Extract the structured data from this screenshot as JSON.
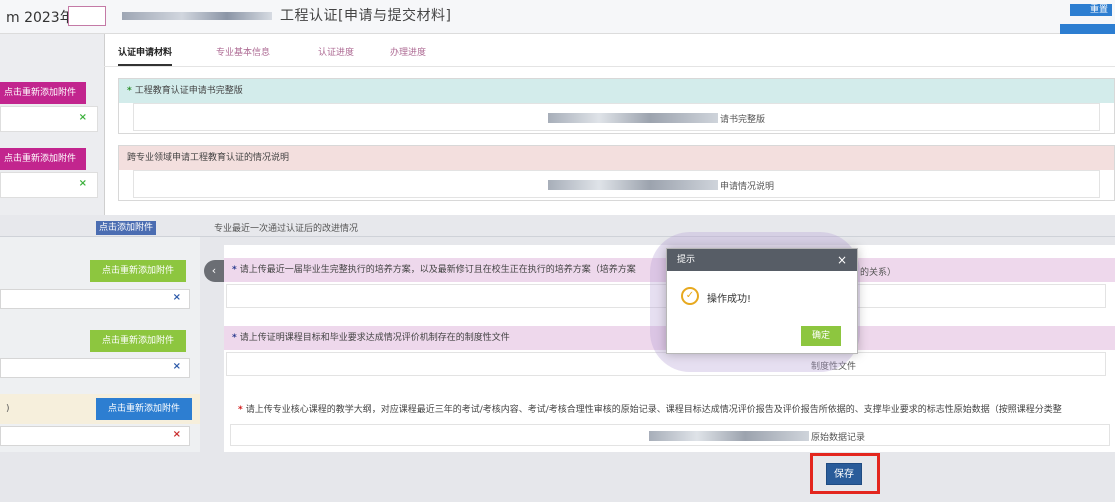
{
  "header": {
    "title_prefix": "m 2023年度",
    "logo_text": "",
    "title": "工程认证[申请与提交材料]",
    "button_label": "重置"
  },
  "tabs": [
    {
      "label": "认证申请材料",
      "active": true
    },
    {
      "label": "专业基本信息",
      "active": false
    },
    {
      "label": "认证进度",
      "active": false
    },
    {
      "label": "办理进度",
      "active": false
    }
  ],
  "left_column": {
    "button1": "点击重新添加附件",
    "button2": "点击重新添加附件",
    "check1": "×",
    "check2": "×"
  },
  "sections_top": [
    {
      "title": "工程教育认证申请书完整版",
      "file_link": "请书完整版",
      "required": true
    },
    {
      "title": "跨专业领域申请工程教育认证的情况说明",
      "file_link": "申请情况说明",
      "required": false
    }
  ],
  "ghost_row": {
    "button": "点击添加附件",
    "text": "专业最近一次通过认证后的改进情况"
  },
  "sections_bottom": [
    {
      "title": "请上传最近一届毕业生完整执行的培养方案，以及最新修订且在校生正在执行的培养方案（培养方案",
      "tail": "的关系）",
      "side_button": "点击重新添加附件",
      "mark": "×"
    },
    {
      "title": "请上传证明课程目标和毕业要求达成情况评价机制存在的制度性文件",
      "file_link": "制度性文件",
      "side_button": "点击重新添加附件",
      "mark": "×"
    },
    {
      "title": "请上传专业核心课程的教学大纲，对应课程最近三年的考试/考核内容、考试/考核合理性审核的原始记录、课程目标达成情况评价报告及评价报告所依据的、支撑毕业要求的标志性原始数据（按照课程分类整",
      "file_link": "原始数据记录",
      "side_button": "点击重新添加附件",
      "mark": "×",
      "left_fragment": ")"
    }
  ],
  "save_label": "保存",
  "modal": {
    "title": "提示",
    "close": "×",
    "message": "操作成功!",
    "ok_label": "确定"
  },
  "colors": {
    "magenta_button": "#c2258e",
    "green_button": "#8dc63f",
    "blue_button": "#2d7ed1",
    "save_highlight": "#e3261e"
  }
}
